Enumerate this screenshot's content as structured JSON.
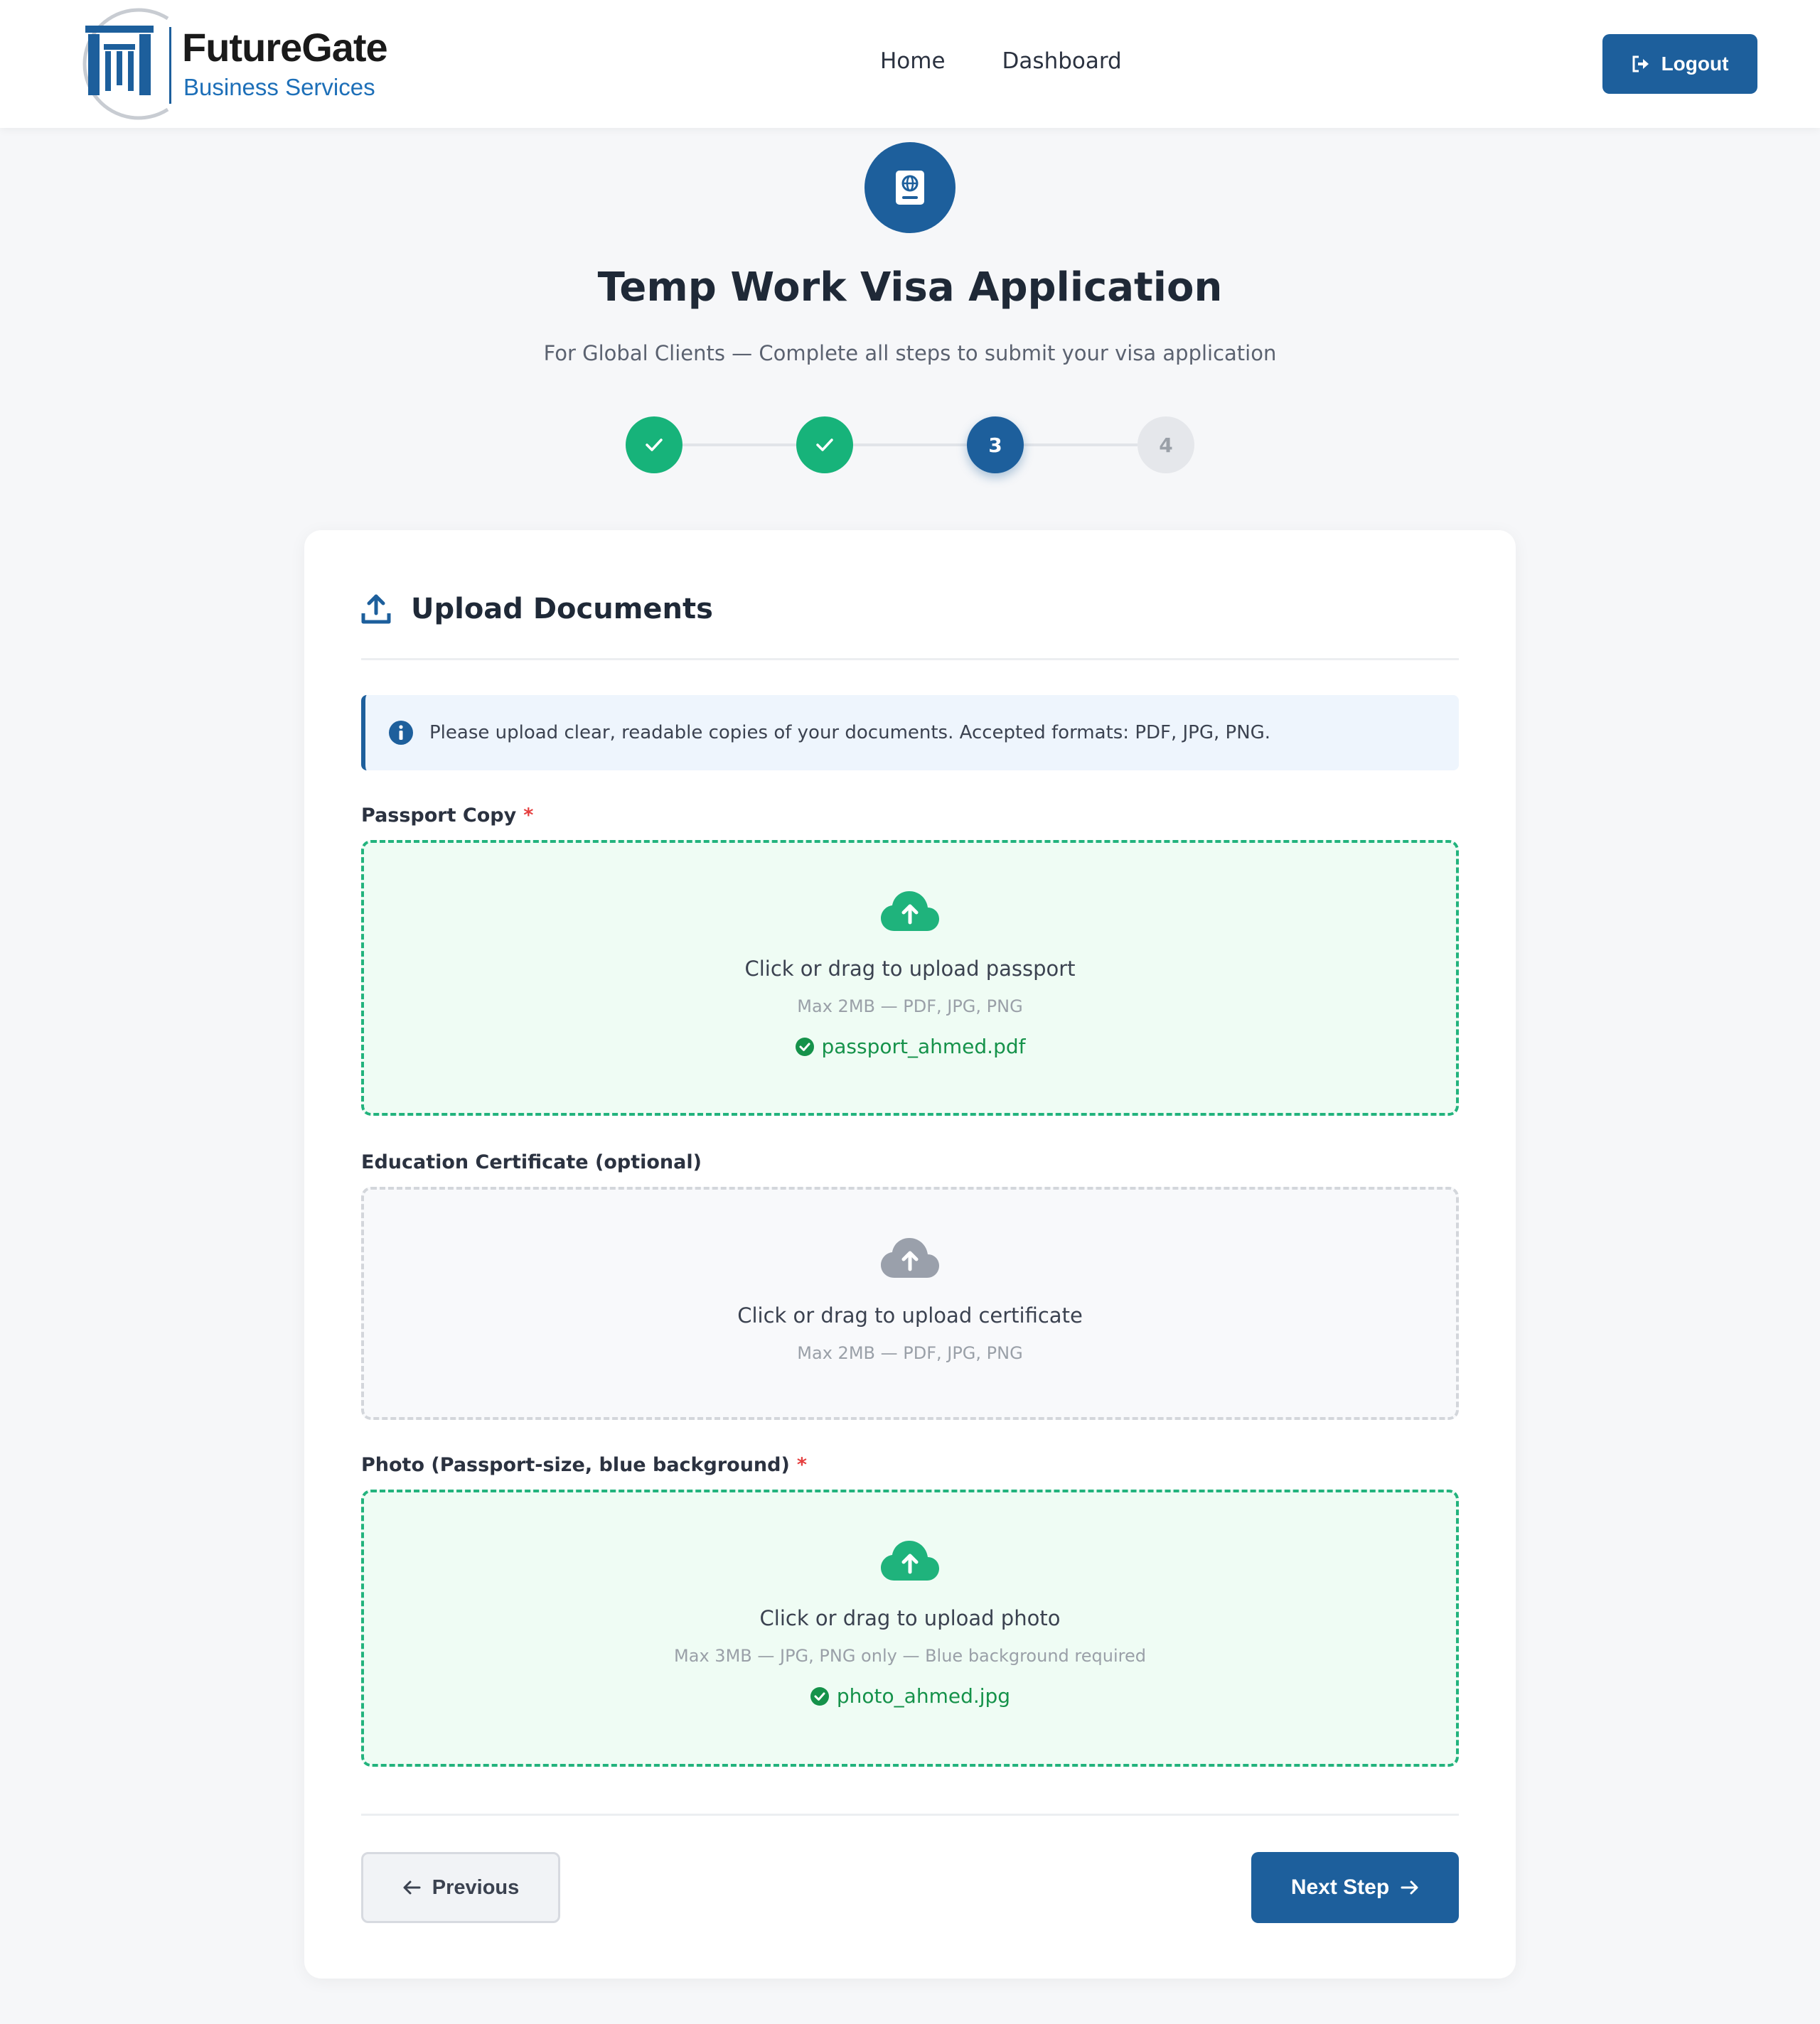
{
  "brand": {
    "name": "FutureGate",
    "tagline": "Business Services"
  },
  "nav": {
    "items": [
      "Home",
      "Dashboard"
    ],
    "logout_label": "Logout"
  },
  "hero": {
    "icon": "passport-icon",
    "title": "Temp Work Visa Application",
    "subtitle": "For Global Clients — Complete all steps to submit your visa application"
  },
  "stepper": {
    "steps": [
      {
        "label": "",
        "state": "done"
      },
      {
        "label": "",
        "state": "done"
      },
      {
        "label": "3",
        "state": "active"
      },
      {
        "label": "4",
        "state": "todo"
      }
    ]
  },
  "section": {
    "title": "Upload Documents",
    "icon": "upload-icon",
    "info": "Please upload clear, readable copies of your documents. Accepted formats: PDF, JPG, PNG."
  },
  "fields": [
    {
      "label": "Passport Copy",
      "required": "*",
      "prompt": "Click or drag to upload passport",
      "hint": "Max 2MB — PDF, JPG, PNG",
      "file": "passport_ahmed.pdf",
      "status": "uploaded"
    },
    {
      "label": "Education Certificate (optional)",
      "required": "",
      "prompt": "Click or drag to upload certificate",
      "hint": "Max 2MB — PDF, JPG, PNG",
      "file": "",
      "status": "empty"
    },
    {
      "label": "Photo (Passport-size, blue background)",
      "required": "*",
      "prompt": "Click or drag to upload photo",
      "hint": "Max 3MB — JPG, PNG only — Blue background required",
      "file": "photo_ahmed.jpg",
      "status": "uploaded"
    }
  ],
  "actions": {
    "previous_label": "Previous",
    "next_label": "Next Step"
  },
  "colors": {
    "primary": "#1d5f9c",
    "success": "#17b37a",
    "required": "#e53e3e"
  }
}
